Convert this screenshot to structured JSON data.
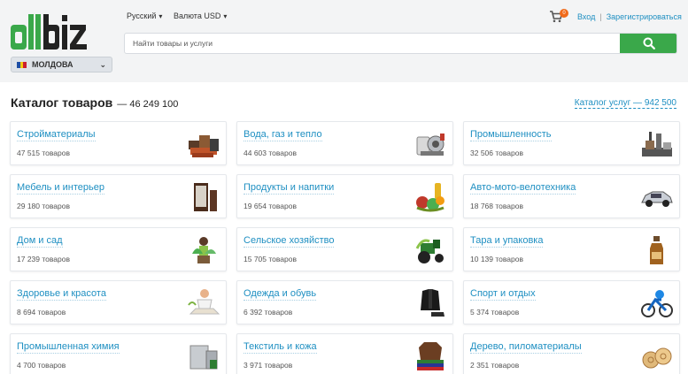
{
  "header": {
    "logo_text": "allbiz",
    "region": "МОЛДОВА",
    "language": "Русский",
    "currency": "Валюта USD",
    "cart_count": "0",
    "login": "Вход",
    "register": "Зарегистрироваться",
    "search_placeholder": "Найти товары и услуги"
  },
  "catalog": {
    "title": "Каталог товаров",
    "count": "— 46 249 100",
    "services_link": "Каталог услуг — 942 500"
  },
  "categories": [
    {
      "name": "Стройматериалы",
      "count": "47 515 товаров",
      "icon": "building-materials-icon"
    },
    {
      "name": "Вода, газ и тепло",
      "count": "44 603 товаров",
      "icon": "water-gas-heat-icon"
    },
    {
      "name": "Промышленность",
      "count": "32 506 товаров",
      "icon": "industry-icon"
    },
    {
      "name": "Мебель и интерьер",
      "count": "29 180 товаров",
      "icon": "furniture-icon"
    },
    {
      "name": "Продукты и напитки",
      "count": "19 654 товаров",
      "icon": "food-drinks-icon"
    },
    {
      "name": "Авто-мото-велотехника",
      "count": "18 768 товаров",
      "icon": "car-icon"
    },
    {
      "name": "Дом и сад",
      "count": "17 239 товаров",
      "icon": "home-garden-icon"
    },
    {
      "name": "Сельское хозяйство",
      "count": "15 705 товаров",
      "icon": "tractor-icon"
    },
    {
      "name": "Тара и упаковка",
      "count": "10 139 товаров",
      "icon": "packaging-icon"
    },
    {
      "name": "Здоровье и красота",
      "count": "8 694 товаров",
      "icon": "health-beauty-icon"
    },
    {
      "name": "Одежда и обувь",
      "count": "6 392 товаров",
      "icon": "clothing-icon"
    },
    {
      "name": "Спорт и отдых",
      "count": "5 374 товаров",
      "icon": "sport-icon"
    },
    {
      "name": "Промышленная химия",
      "count": "4 700 товаров",
      "icon": "chemistry-icon"
    },
    {
      "name": "Текстиль и кожа",
      "count": "3 971 товаров",
      "icon": "textile-leather-icon"
    },
    {
      "name": "Дерево, пиломатериалы",
      "count": "2 351 товаров",
      "icon": "lumber-icon"
    }
  ],
  "colors": {
    "accent_green": "#3aa84a",
    "link_blue": "#1e8fc2",
    "header_bg": "#f3f4f5",
    "badge_orange": "#f06a1a"
  }
}
